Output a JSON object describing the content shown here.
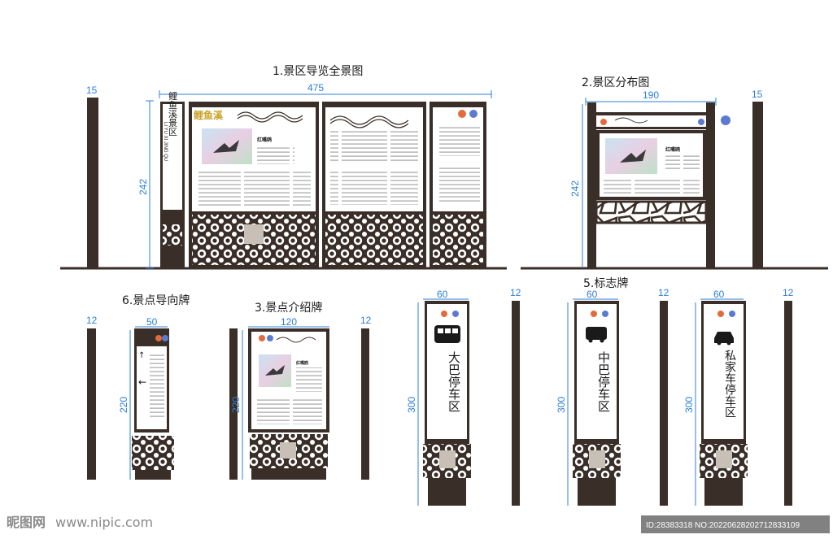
{
  "titles": {
    "panorama": "1.景区导览全景图",
    "distribution": "2.景区分布图",
    "intro": "3.景点介绍牌",
    "marker": "5.标志牌",
    "direction": "6.景点导向牌"
  },
  "dimensions": {
    "panorama_width": "475",
    "panorama_height": "242",
    "panorama_post": "15",
    "distribution_width": "190",
    "distribution_height": "242",
    "distribution_post": "15",
    "direction_width": "50",
    "direction_height": "220",
    "direction_post": "12",
    "intro_width": "120",
    "intro_height": "220",
    "intro_post": "12",
    "marker_width": "60",
    "marker_height": "300",
    "marker_post": "12"
  },
  "panorama": {
    "pillar_text": "鲤鱼溪景区",
    "pillar_pinyin": "LI YU XI JING QU",
    "banner": "鲤鱼溪",
    "bird_name": "红嘴鸥"
  },
  "distribution": {
    "bird_name": "红嘴鸥"
  },
  "intro": {
    "bird_name": "红嘴鸥"
  },
  "markers": [
    {
      "label": "大巴停车区",
      "icon": "bus-icon"
    },
    {
      "label": "中巴停车区",
      "icon": "minibus-icon"
    },
    {
      "label": "私家车停车区",
      "icon": "car-icon"
    }
  ],
  "colors": {
    "frame": "#3a2e28",
    "dimension": "#2d7fd8"
  },
  "watermark": {
    "logo": "昵图网",
    "url": "www.nipic.com",
    "id": "ID:28383318 NO:20220628202712833109"
  }
}
